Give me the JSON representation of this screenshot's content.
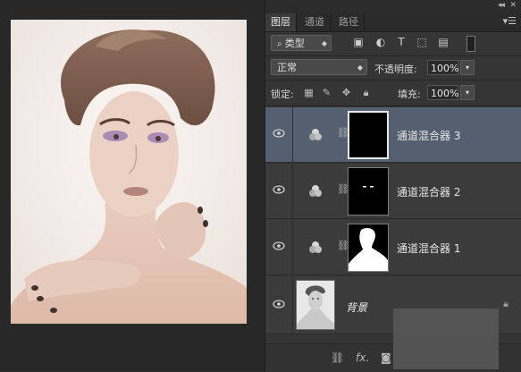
{
  "layers_panel": {
    "tabs": [
      {
        "label": "图层",
        "active": true
      },
      {
        "label": "通道",
        "active": false
      },
      {
        "label": "路径",
        "active": false
      }
    ],
    "filter": {
      "kind_label": "类型",
      "icons": [
        "image-filter-icon",
        "adjustment-filter-icon",
        "type-filter-icon",
        "shape-filter-icon",
        "smart-object-filter-icon",
        "filter-toggle-icon"
      ]
    },
    "blend_mode": "正常",
    "opacity_label": "不透明度:",
    "opacity_value": "100%",
    "lock_label": "锁定:",
    "lock_icons": [
      "lock-transparent-icon",
      "lock-image-icon",
      "lock-position-icon",
      "lock-all-icon"
    ],
    "fill_label": "填充:",
    "fill_value": "100%",
    "layers": [
      {
        "name": "通道混合器 3",
        "type": "adjustment",
        "visible": true,
        "selected": true
      },
      {
        "name": "通道混合器 2",
        "type": "adjustment",
        "visible": true,
        "selected": false
      },
      {
        "name": "通道混合器 1",
        "type": "adjustment",
        "visible": true,
        "selected": false
      },
      {
        "name": "背景",
        "type": "background",
        "visible": true,
        "selected": false,
        "locked": true
      }
    ],
    "bottom_icons": [
      "link-layers-icon",
      "fx-icon",
      "add-mask-icon"
    ],
    "bottom_fx_label": "fx."
  },
  "colors": {
    "selected_layer": "#54606f",
    "panel_bg": "#353535",
    "canvas_bg": "#282828"
  }
}
